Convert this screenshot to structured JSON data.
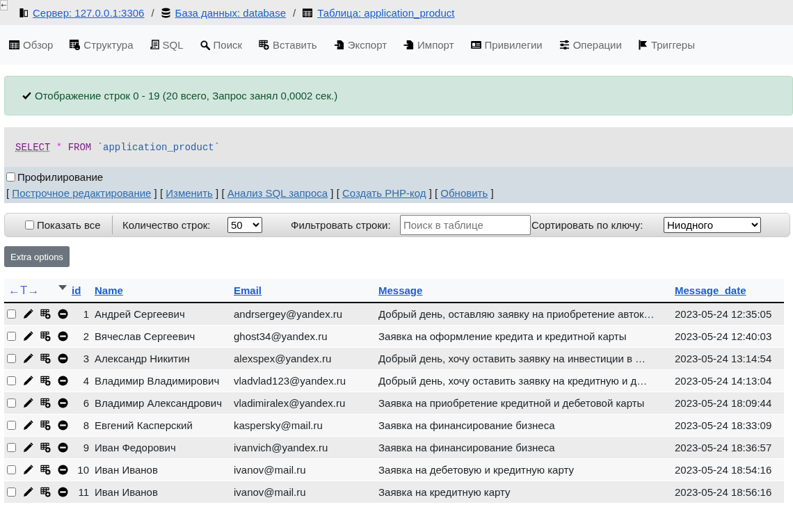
{
  "nav_toggle": "←",
  "breadcrumb": [
    {
      "kind": "server",
      "label": "Сервер: 127.0.0.1:3306"
    },
    {
      "kind": "database",
      "separator": "/",
      "label": "База данных: database"
    },
    {
      "kind": "table",
      "separator": "/",
      "label": "Таблица: application_product"
    }
  ],
  "tabs": [
    {
      "kind": "browse",
      "label": "Обзор"
    },
    {
      "kind": "structure",
      "label": "Структура"
    },
    {
      "kind": "sql",
      "label": "SQL"
    },
    {
      "kind": "search",
      "label": "Поиск"
    },
    {
      "kind": "insert",
      "label": "Вставить"
    },
    {
      "kind": "export",
      "label": "Экспорт"
    },
    {
      "kind": "import",
      "label": "Импорт"
    },
    {
      "kind": "privileges",
      "label": "Привилегии"
    },
    {
      "kind": "operations",
      "label": "Операции"
    },
    {
      "kind": "triggers",
      "label": "Триггеры"
    }
  ],
  "message": "Отображение строк 0 - 19 (20 всего, Запрос занял 0,0002 сек.)",
  "sql_query": [
    {
      "kind": "doclink",
      "text": "SELECT"
    },
    {
      "kind": "operator",
      "text": "*"
    },
    {
      "kind": "keyword",
      "text": "FROM"
    },
    {
      "kind": "identifier",
      "text": "`application_product`"
    }
  ],
  "profiling": {
    "label": "Профилирование",
    "checked": false
  },
  "query_links": [
    {
      "open": "[",
      "label": "Построчное редактирование",
      "close": "]"
    },
    {
      "open": "[",
      "label": "Изменить",
      "close": "]"
    },
    {
      "open": "[",
      "label": "Анализ SQL запроса",
      "close": "]"
    },
    {
      "open": "[",
      "label": "Создать PHP-код",
      "close": "]"
    },
    {
      "open": "[",
      "label": "Обновить",
      "close": "]"
    }
  ],
  "navigation": {
    "show_all": {
      "label": "Показать все",
      "checked": false
    },
    "rows_label": "Количество строк:",
    "rows_value": "50",
    "filter_label": "Фильтровать строки:",
    "filter_placeholder": "Поиск в таблице",
    "sort_label": "Сортировать по ключу:",
    "sort_value": "Ниодного"
  },
  "extra_options_button": "Extra options",
  "table": {
    "toggle": "←T→",
    "columns": [
      "id",
      "Name",
      "Email",
      "Message",
      "Message_date"
    ],
    "rows": [
      {
        "checked": false,
        "cells": [
          "1",
          "Андрей Сергеевич",
          "andrsergey@yandex.ru",
          "Добрый день, оставляю заявку на приобретение авток…",
          "2023-05-24 12:35:05"
        ]
      },
      {
        "checked": false,
        "cells": [
          "2",
          "Вячеслав Сергеевич",
          "ghost34@yandex.ru",
          "Заявка на оформление кредита и кредитной карты",
          "2023-05-24 12:40:03"
        ]
      },
      {
        "checked": false,
        "cells": [
          "3",
          "Александр Никитин",
          "alexspex@yandex.ru",
          "Добрый день, хочу оставить заявку на инвестиции в …",
          "2023-05-24 13:14:54"
        ]
      },
      {
        "checked": false,
        "cells": [
          "4",
          "Владимир Владимирович",
          "vladvlad123@yandex.ru",
          "Добрый день, хочу оставить заявку на кредитную и д…",
          "2023-05-24 14:13:04"
        ]
      },
      {
        "checked": false,
        "cells": [
          "6",
          "Владимир Александрович",
          "vladimiralex@yandex.ru",
          "Заявка на приобретение кредитной и дебетовой карты",
          "2023-05-24 18:09:44"
        ]
      },
      {
        "checked": false,
        "cells": [
          "8",
          "Евгений Касперский",
          "kaspersky@mail.ru",
          "Заявка на финансирование бизнеса",
          "2023-05-24 18:33:09"
        ]
      },
      {
        "checked": false,
        "cells": [
          "9",
          "Иван Федорович",
          "ivanvich@yandex.ru",
          "Заявка на финансирование бизнеса",
          "2023-05-24 18:36:57"
        ]
      },
      {
        "checked": false,
        "cells": [
          "10",
          "Иван Иванов",
          "ivanov@mail.ru",
          "Заявка на дебетовую и кредитную карту",
          "2023-05-24 18:54:16"
        ]
      },
      {
        "checked": false,
        "cells": [
          "11",
          "Иван Иванов",
          "ivanov@mail.ru",
          "Заявка на кредитную карту",
          "2023-05-24 18:56:16"
        ]
      }
    ]
  }
}
